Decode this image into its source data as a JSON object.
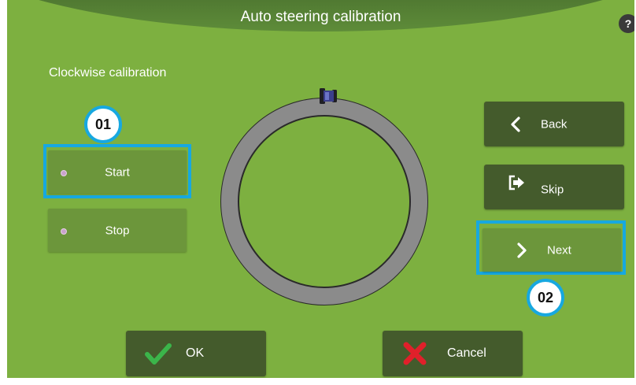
{
  "title": "Auto steering calibration",
  "help_label": "?",
  "section_label": "Clockwise calibration",
  "left_buttons": {
    "start": "Start",
    "stop": "Stop"
  },
  "right_buttons": {
    "back": "Back",
    "skip": "Skip",
    "next": "Next"
  },
  "bottom_buttons": {
    "ok": "OK",
    "cancel": "Cancel"
  },
  "callouts": {
    "first": "01",
    "second": "02"
  },
  "colors": {
    "background": "#7db040",
    "highlight": "#17a8e0",
    "dark_button": "#445b2c"
  },
  "icons": {
    "back": "chevron-left-icon",
    "skip": "exit-arrow-icon",
    "next": "chevron-right-icon",
    "ok": "checkmark-icon",
    "cancel": "cross-icon",
    "vehicle": "tractor-icon"
  }
}
